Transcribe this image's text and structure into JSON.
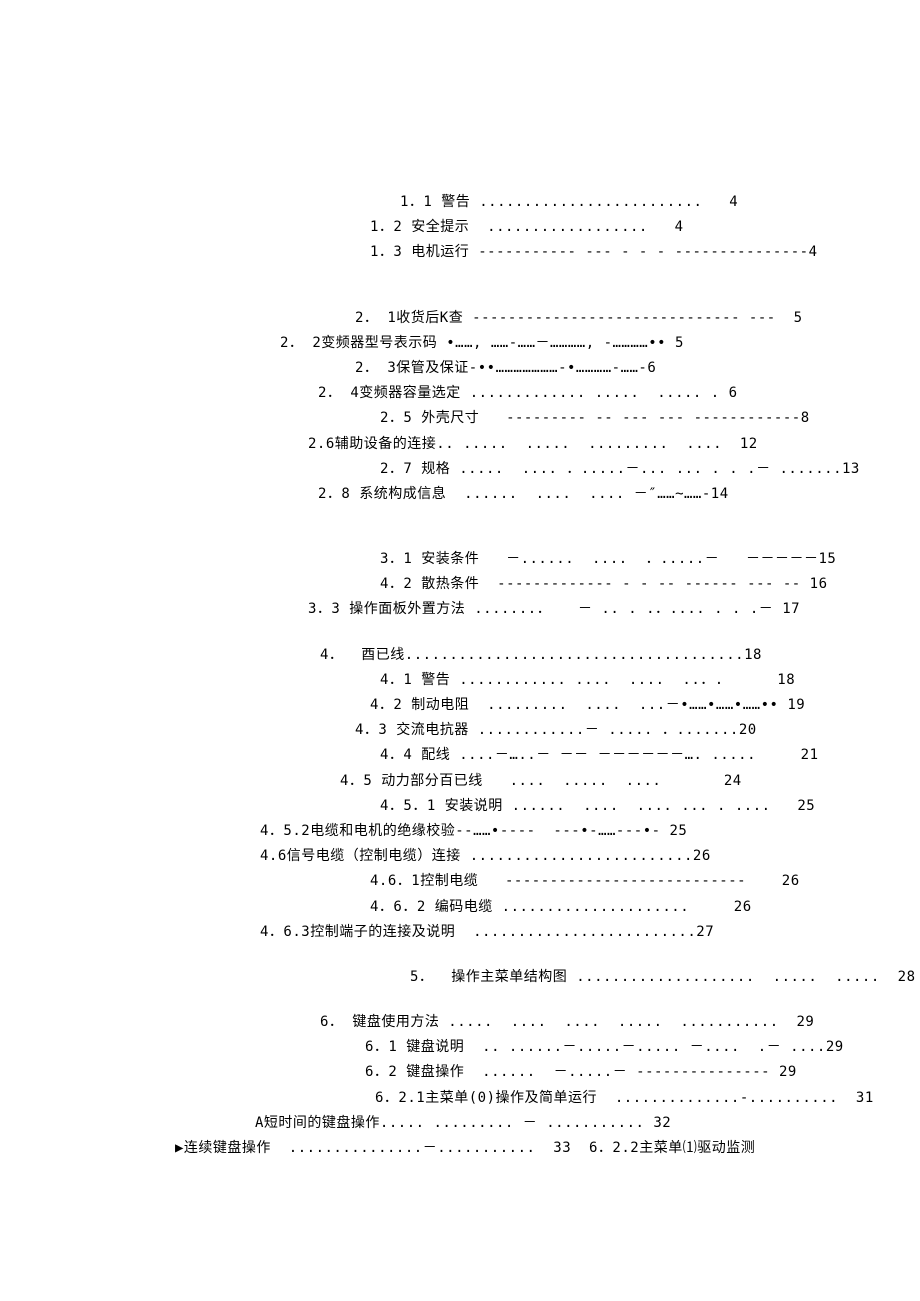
{
  "toc": [
    {
      "text": "1．1 警告 .........................   4",
      "indent": 320
    },
    {
      "text": "1．2 安全提示  ..................   4",
      "indent": 290
    },
    {
      "text": "1．3 电机运行 ----------- --- - - - ---------------4",
      "indent": 290
    },
    {
      "spacer": true,
      "size": "lg"
    },
    {
      "text": "2． 1收货后K查 ------------------------------ ---  5",
      "indent": 275
    },
    {
      "text": "2． 2变频器型号表示码 •……, ……-……－…………, -…………•• 5",
      "indent": 200
    },
    {
      "text": "2． 3保管及保证-••…………………-•…………-……-6",
      "indent": 275
    },
    {
      "text": "2． 4变频器容量选定 ............. .....  ..... . 6",
      "indent": 238
    },
    {
      "text": "2．5 外壳尺寸   --------- -- --- --- ------------8",
      "indent": 300
    },
    {
      "text": "2.6辅助设备的连接.. .....  .....  .........  ....  12",
      "indent": 228
    },
    {
      "text": "2．7 规格 .....  .... ．.....－... ... . . .－ .......13",
      "indent": 300
    },
    {
      "text": "2．8 系统构成信息  ......  ....  .... －″……~……-14",
      "indent": 238
    },
    {
      "spacer": true,
      "size": "lg"
    },
    {
      "text": "3．1 安装条件   －......  ....  ．.....－   －－－－－15",
      "indent": 300
    },
    {
      "text": "4．2 散热条件  ------------- - - -- ------ --- -- 16",
      "indent": 300
    },
    {
      "text": "3．3 操作面板外置方法 .......．   － .. . .．.... . . .－ 17",
      "indent": 228
    },
    {
      "spacer": true,
      "size": "sm"
    },
    {
      "text": "4．  酉已线......................................18",
      "indent": 240
    },
    {
      "text": "4．1 警告 ............ ....  ....  ..．.      18",
      "indent": 300
    },
    {
      "text": "4．2 制动电阻  .........  ....  ...－•……•……•……•• 19",
      "indent": 290
    },
    {
      "text": "4．3 交流电抗器 ............－ ..... ．.......20",
      "indent": 275
    },
    {
      "text": "4．4 配线 ....－…..－ －－ －－－－－－…. .....     21",
      "indent": 300
    },
    {
      "text": "4．5 动力部分百已线   ....  .....  ....       24",
      "indent": 260
    },
    {
      "text": "4．5．1 安装说明 ......  ....  .... ... . ....   25",
      "indent": 300
    },
    {
      "text": "4．5.2电缆和电机的绝缘校验--……•----  ---•-……---•- 25",
      "indent": 180
    },
    {
      "text": "4.6信号电缆（控制电缆）连接 .........................26",
      "indent": 180
    },
    {
      "text": "4.6．1控制电缆   ---------------------------    26",
      "indent": 290
    },
    {
      "text": "4．6．2 编码电缆 .....................     26",
      "indent": 290
    },
    {
      "text": "4．6.3控制端子的连接及说明  .........................27",
      "indent": 180
    },
    {
      "spacer": true,
      "size": "sm"
    },
    {
      "text": "5．  操作主菜单结构图 ....................  .....  .....  28",
      "indent": 330
    },
    {
      "spacer": true,
      "size": "sm"
    },
    {
      "text": "6． 键盘使用方法 .....  ....  ....  .....  ...........  29",
      "indent": 240
    },
    {
      "text": "6．1 键盘说明  .. ......－.....－..... －....  .－ ....29",
      "indent": 285
    },
    {
      "text": "6．2 键盘操作  ......  －.....－ --------------- 29",
      "indent": 285
    },
    {
      "text": "6．2.1主菜单(0)操作及简单运行  ..............-..........  31",
      "indent": 295
    },
    {
      "text": "A短时间的键盘操作..... ......... － ........... 32",
      "indent": 175
    },
    {
      "text": "▶连续键盘操作  ...............－...........  33  6．2.2主菜单⑴驱动监测",
      "indent": 95
    }
  ]
}
